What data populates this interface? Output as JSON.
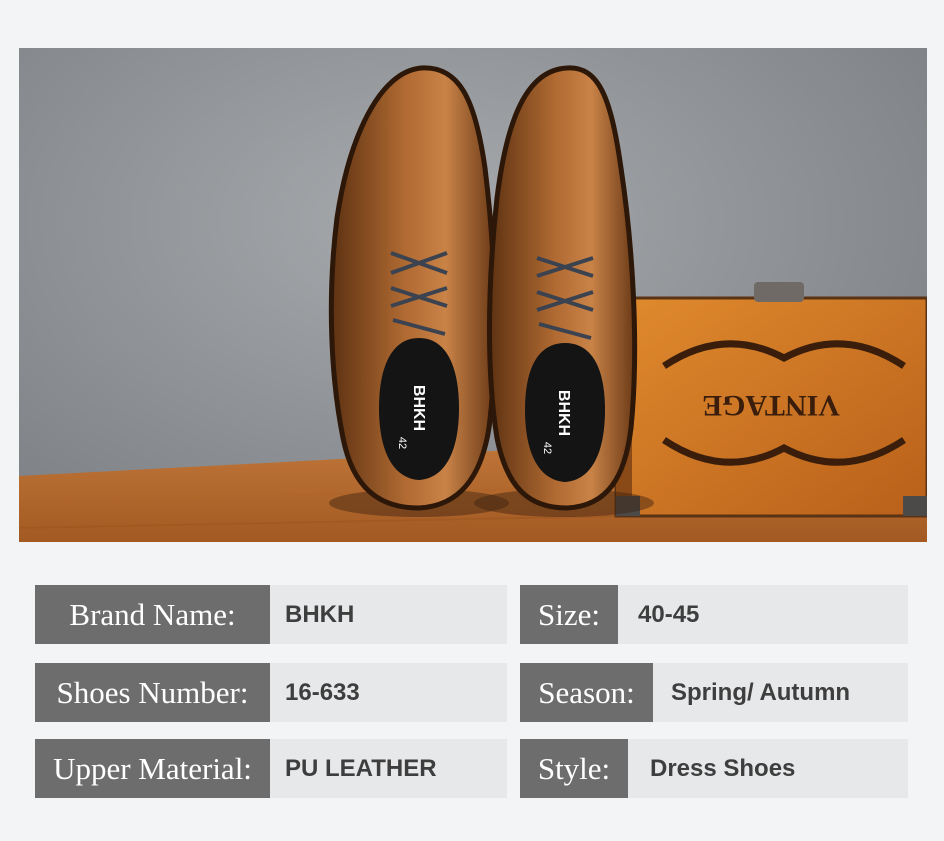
{
  "photo": {
    "box_brand_stamp": "VINTAGE",
    "insole_brand": "BHKH",
    "insole_size": "42"
  },
  "specs": {
    "brand": {
      "label": "Brand Name:",
      "value": "BHKH"
    },
    "size": {
      "label": "Size:",
      "value": "40-45"
    },
    "number": {
      "label": "Shoes Number:",
      "value": "16-633"
    },
    "season": {
      "label": "Season:",
      "value": "Spring/ Autumn"
    },
    "material": {
      "label": "Upper Material:",
      "value": "PU LEATHER"
    },
    "style": {
      "label": "Style:",
      "value": "Dress Shoes"
    }
  },
  "colors": {
    "label_bg": "#6d6d6d",
    "value_bg": "#e7e8e9",
    "page_bg": "#f3f4f5",
    "leather": "#9a5a2a"
  }
}
